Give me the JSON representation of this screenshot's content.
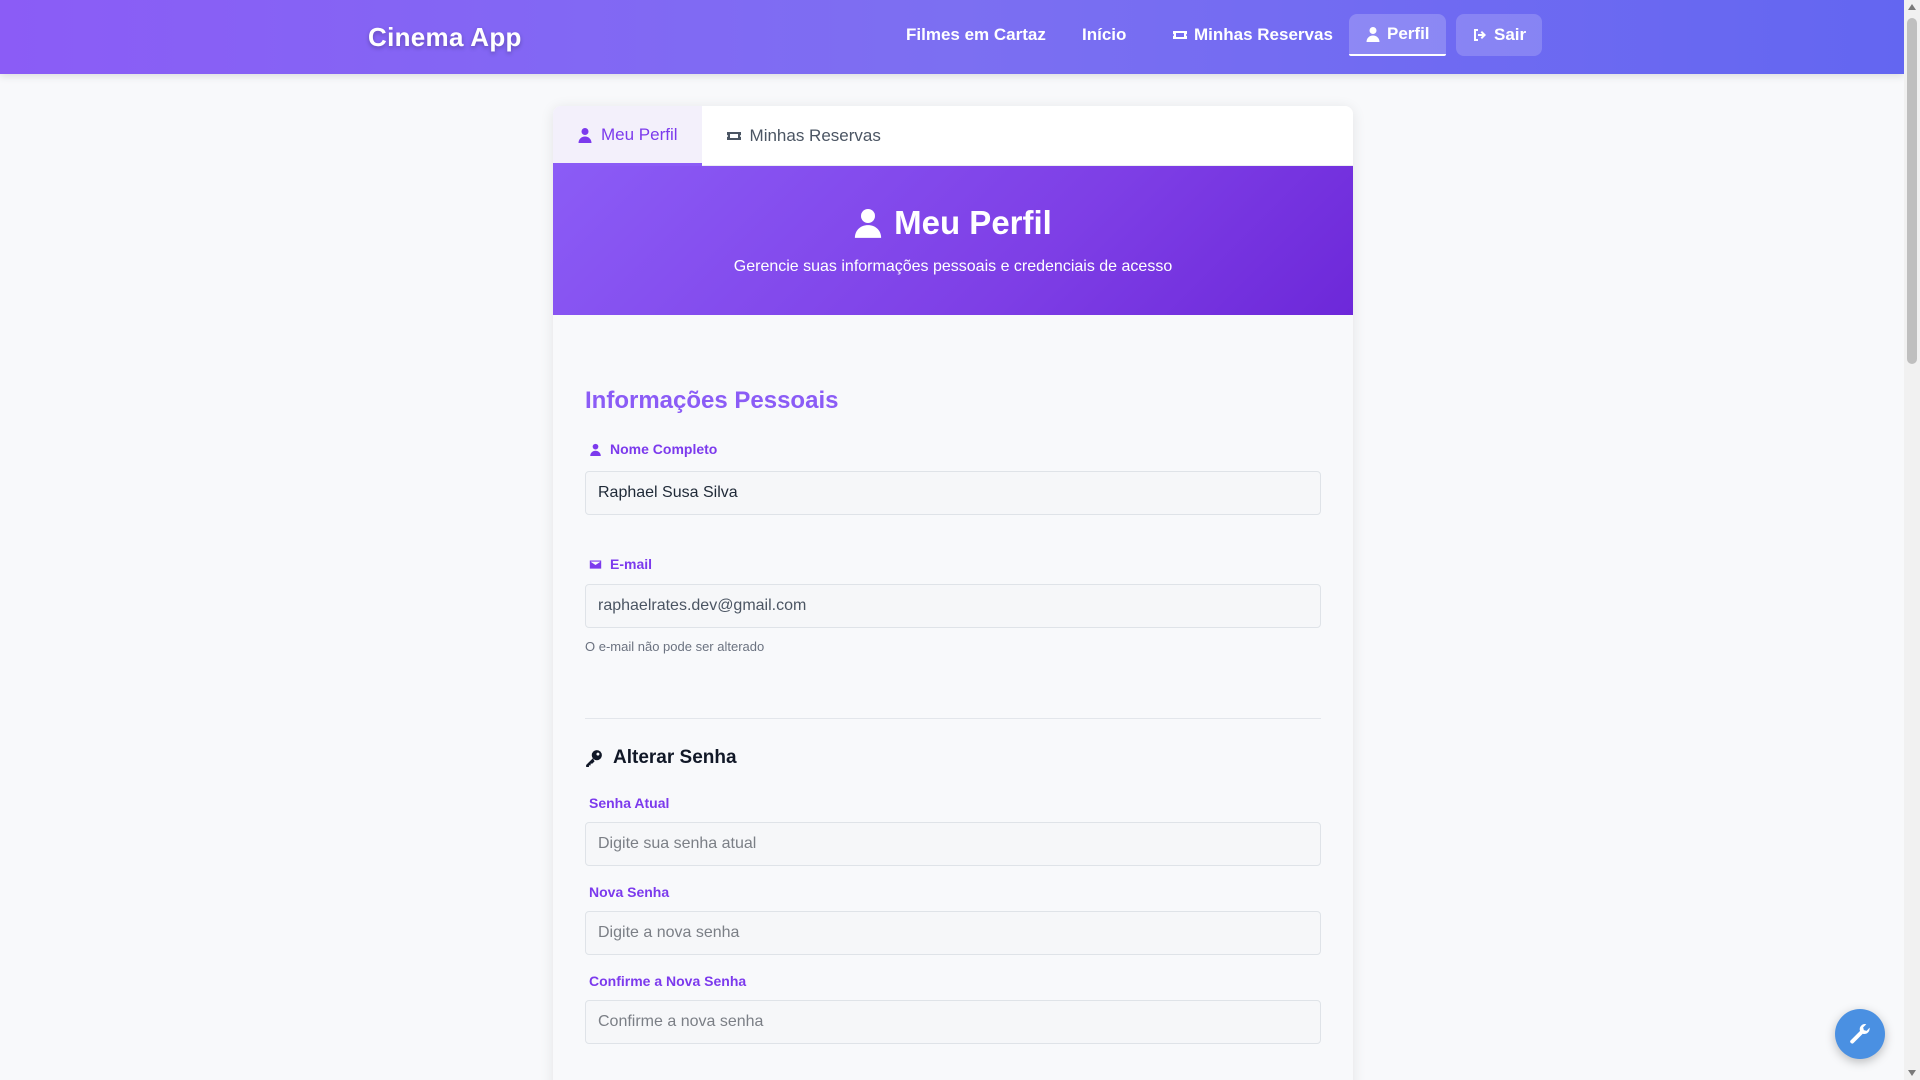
{
  "navbar": {
    "brand": "Cinema App",
    "items": [
      {
        "label": "Filmes em Cartaz",
        "icon": ""
      },
      {
        "label": "Início",
        "icon": ""
      },
      {
        "label": "Minhas Reservas",
        "icon": "ticket-icon"
      },
      {
        "label": "Perfil",
        "icon": "user-icon",
        "active": true
      },
      {
        "label": "Sair",
        "icon": "logout-icon"
      }
    ]
  },
  "tabs": [
    {
      "label": "Meu Perfil",
      "icon": "user-icon",
      "active": true
    },
    {
      "label": "Minhas Reservas",
      "icon": "ticket-icon"
    }
  ],
  "hero": {
    "title": "Meu Perfil",
    "subtitle": "Gerencie suas informações pessoais e credenciais de acesso"
  },
  "personal": {
    "title": "Informações Pessoais",
    "name_label": "Nome Completo",
    "name_value": "Raphael Susa Silva",
    "email_label": "E-mail",
    "email_value": "raphaelrates.dev@gmail.com",
    "email_hint": "O e-mail não pode ser alterado"
  },
  "password": {
    "title": "Alterar Senha",
    "current_label": "Senha Atual",
    "current_placeholder": "Digite sua senha atual",
    "new_label": "Nova Senha",
    "new_placeholder": "Digite a nova senha",
    "confirm_label": "Confirme a Nova Senha",
    "confirm_placeholder": "Confirme a nova senha"
  },
  "colors": {
    "accent": "#8b5cf6",
    "accent_dark": "#7c3aed",
    "fab": "#4a90e2"
  }
}
